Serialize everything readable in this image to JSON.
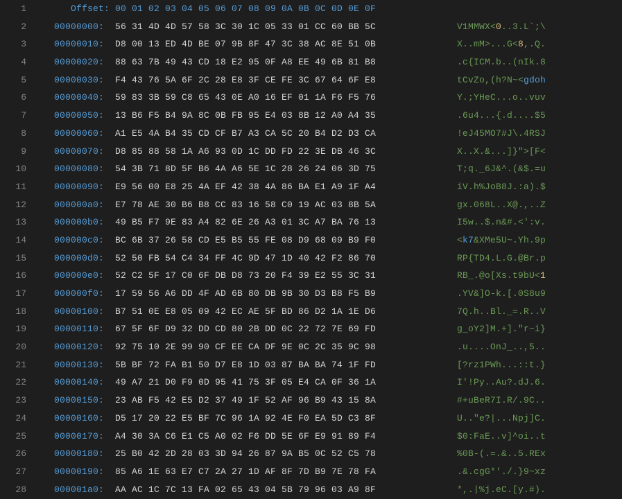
{
  "header": {
    "label": "Offset:",
    "columns": "00 01 02 03 04 05 06 07 08 09 0A 0B 0C 0D 0E 0F"
  },
  "rows": [
    {
      "off": "00000000:",
      "hex": "56 31 4D 4D 57 58 3C 30 1C 05 33 01 CC 60 BB 5C",
      "ascii_seg": [
        {
          "t": "V1MMWX<",
          "c": ""
        },
        {
          "t": "0",
          "c": "yellow"
        },
        {
          "t": "..3.L`;\\",
          "c": ""
        }
      ]
    },
    {
      "off": "00000010:",
      "hex": "D8 00 13 ED 4D BE 07 9B 8F 47 3C 38 AC 8E 51 0B",
      "ascii_seg": [
        {
          "t": "X..mM>...G<",
          "c": ""
        },
        {
          "t": "8",
          "c": "yellow"
        },
        {
          "t": ",.Q.",
          "c": ""
        }
      ]
    },
    {
      "off": "00000020:",
      "hex": "88 63 7B 49 43 CD 18 E2 95 0F A8 EE 49 6B 81 B8",
      "ascii": ".c{ICM.b..(nIk.8"
    },
    {
      "off": "00000030:",
      "hex": "F4 43 76 5A 6F 2C 28 E8 3F CE FE 3C 67 64 6F E8",
      "ascii_seg": [
        {
          "t": "tCvZo,(h?N~<",
          "c": ""
        },
        {
          "t": "gdoh",
          "c": "blue"
        }
      ]
    },
    {
      "off": "00000040:",
      "hex": "59 83 3B 59 C8 65 43 0E A0 16 EF 01 1A F6 F5 76",
      "ascii": "Y.;YHeC...o..vuv"
    },
    {
      "off": "00000050:",
      "hex": "13 B6 F5 B4 9A 8C 0B FB 95 E4 03 8B 12 A0 A4 35",
      "ascii": ".6u4...{.d....$5"
    },
    {
      "off": "00000060:",
      "hex": "A1 E5 4A B4 35 CD CF B7 A3 CA 5C 20 B4 D2 D3 CA",
      "ascii": "!eJ45MO7#J\\.4RSJ"
    },
    {
      "off": "00000070:",
      "hex": "D8 85 88 58 1A A6 93 0D 1C DD FD 22 3E DB 46 3C",
      "ascii": "X..X.&...]}\">[F<"
    },
    {
      "off": "00000080:",
      "hex": "54 3B 71 8D 5F B6 4A A6 5E 1C 28 26 24 06 3D 75",
      "ascii": "T;q._6J&^.(&$.=u"
    },
    {
      "off": "00000090:",
      "hex": "E9 56 00 E8 25 4A EF 42 38 4A 86 BA E1 A9 1F A4",
      "ascii": "iV.h%JoB8J.:a).$"
    },
    {
      "off": "000000a0:",
      "hex": "E7 78 AE 30 B6 B8 CC 83 16 58 C0 19 AC 03 8B 5A",
      "ascii": "gx.068L..X@.,..Z"
    },
    {
      "off": "000000b0:",
      "hex": "49 B5 F7 9E 83 A4 82 6E 26 A3 01 3C A7 BA 76 13",
      "ascii": "I5w..$.n&#.<':v."
    },
    {
      "off": "000000c0:",
      "hex": "BC 6B 37 26 58 CD E5 B5 55 FE 08 D9 68 09 B9 F0",
      "ascii_seg": [
        {
          "t": "<",
          "c": ""
        },
        {
          "t": "k7",
          "c": "blue"
        },
        {
          "t": "&XMe5U~.Yh.9p",
          "c": ""
        }
      ]
    },
    {
      "off": "000000d0:",
      "hex": "52 50 FB 54 C4 34 FF 4C 9D 47 1D 40 42 F2 86 70",
      "ascii": "RP{TD4.L.G.@Br.p"
    },
    {
      "off": "000000e0:",
      "hex": "52 C2 5F 17 C0 6F DB D8 73 20 F4 39 E2 55 3C 31",
      "ascii_seg": [
        {
          "t": "RB_.@o[Xs.t9bU<",
          "c": ""
        },
        {
          "t": "1",
          "c": "yellow"
        }
      ]
    },
    {
      "off": "000000f0:",
      "hex": "17 59 56 A6 DD 4F AD 6B 80 DB 9B 30 D3 B8 F5 B9",
      "ascii": ".YV&]O-k.[.0S8u9"
    },
    {
      "off": "00000100:",
      "hex": "B7 51 0E E8 05 09 42 EC AE 5F BD 86 D2 1A 1E D6",
      "ascii": "7Q.h..Bl._=.R..V"
    },
    {
      "off": "00000110:",
      "hex": "67 5F 6F D9 32 DD CD 80 2B DD 0C 22 72 7E 69 FD",
      "ascii": "g_oY2]M.+].\"r~i}"
    },
    {
      "off": "00000120:",
      "hex": "92 75 10 2E 99 90 CF EE CA DF 9E 0C 2C 35 9C 98",
      "ascii": ".u....OnJ_..,5.."
    },
    {
      "off": "00000130:",
      "hex": "5B BF 72 FA B1 50 D7 E8 1D 03 87 BA BA 74 1F FD",
      "ascii": "[?rz1PWh...::t.}"
    },
    {
      "off": "00000140:",
      "hex": "49 A7 21 D0 F9 0D 95 41 75 3F 05 E4 CA 0F 36 1A",
      "ascii": "I'!Py..Au?.dJ.6."
    },
    {
      "off": "00000150:",
      "hex": "23 AB F5 42 E5 D2 37 49 1F 52 AF 96 B9 43 15 8A",
      "ascii": "#+uBeR7I.R/.9C.."
    },
    {
      "off": "00000160:",
      "hex": "D5 17 20 22 E5 BF 7C 96 1A 92 4E F0 EA 5D C3 8F",
      "ascii": "U..\"e?|...Npj]C."
    },
    {
      "off": "00000170:",
      "hex": "A4 30 3A C6 E1 C5 A0 02 F6 DD 5E 6F E9 91 89 F4",
      "ascii": "$0:FaE..v]^oi..t"
    },
    {
      "off": "00000180:",
      "hex": "25 B0 42 2D 28 03 3D 94 26 87 9A B5 0C 52 C5 78",
      "ascii": "%0B-(.=.&..5.REx"
    },
    {
      "off": "00000190:",
      "hex": "85 A6 1E 63 E7 C7 2A 27 1D AF 8F 7D B9 7E 78 FA",
      "ascii": ".&.cgG*'./.}9~xz"
    },
    {
      "off": "000001a0:",
      "hex": "AA AC 1C 7C 13 FA 02 65 43 04 5B 79 96 03 A9 8F",
      "ascii": "*,.|%j.eC.[y.#)."
    }
  ]
}
